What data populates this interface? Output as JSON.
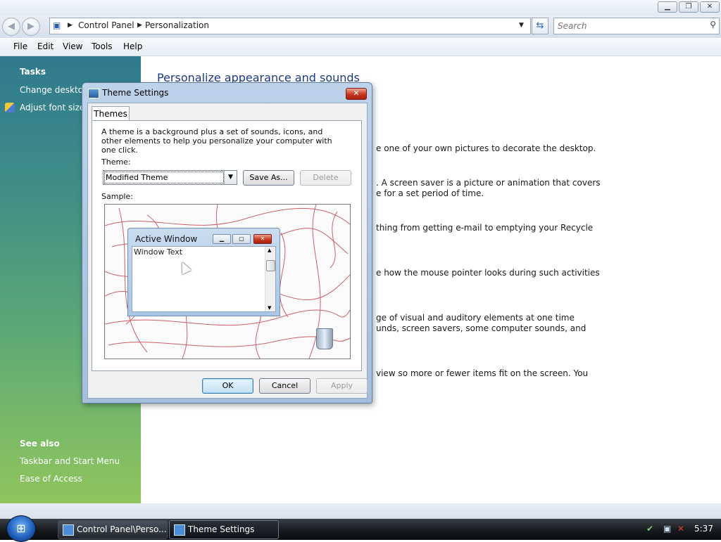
{
  "window": {
    "minimize": "▁",
    "maximize": "❐",
    "close": "✕"
  },
  "address": {
    "crumbs": [
      "Control Panel",
      "Personalization"
    ],
    "search_placeholder": "Search"
  },
  "menu": [
    "File",
    "Edit",
    "View",
    "Tools",
    "Help"
  ],
  "sidebar": {
    "tasks_heading": "Tasks",
    "tasks": [
      "Change desktop",
      "Adjust font size ("
    ],
    "see_also_heading": "See also",
    "see_also": [
      "Taskbar and Start Menu",
      "Ease of Access"
    ]
  },
  "main": {
    "title": "Personalize appearance and sounds",
    "lines": [
      "e one of your own pictures to decorate the desktop.",
      ". A screen saver is a picture or animation that covers",
      "e for a set period of time.",
      "thing from getting e-mail to emptying your Recycle",
      "e how the mouse pointer looks during such activities",
      "ge of visual and auditory elements at one time",
      "unds, screen savers, some computer sounds, and",
      "view so more or fewer items fit on the screen. You"
    ]
  },
  "dialog": {
    "title": "Theme Settings",
    "close": "✕",
    "tab": "Themes",
    "description": "A theme is a background plus a set of sounds, icons, and other elements to help you personalize your computer with one click.",
    "theme_label": "Theme:",
    "theme_value": "Modified Theme",
    "save_as": "Save As...",
    "delete": "Delete",
    "sample_label": "Sample:",
    "preview": {
      "window_title": "Active Window",
      "window_text": "Window Text"
    },
    "ok": "OK",
    "cancel": "Cancel",
    "apply": "Apply"
  },
  "taskbar": {
    "start": "⊞",
    "items": [
      "Control Panel\\Perso...",
      "Theme Settings"
    ],
    "clock": "5:37"
  },
  "colors": {
    "wallpaper_lines": "#c8434f",
    "accent": "#1e3a8a"
  }
}
